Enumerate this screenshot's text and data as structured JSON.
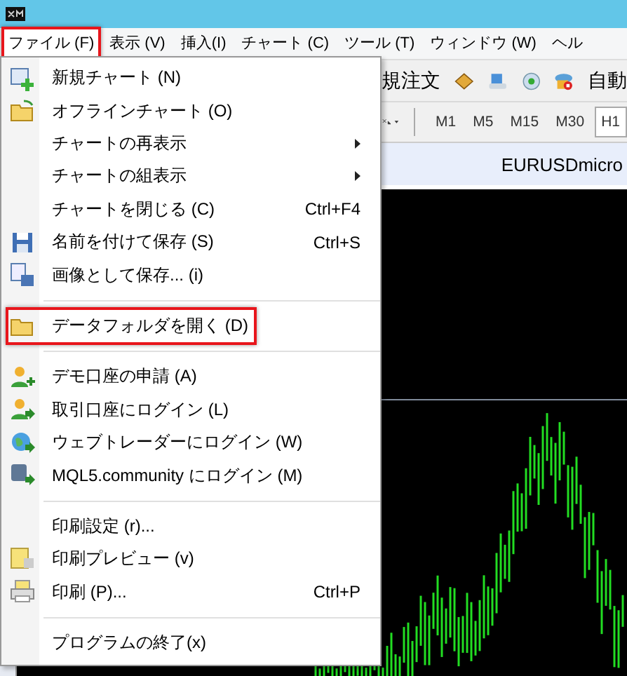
{
  "menubar": [
    {
      "label": "ファイル (F)",
      "selected": true
    },
    {
      "label": "表示 (V)",
      "selected": false
    },
    {
      "label": "挿入(I)",
      "selected": false
    },
    {
      "label": "チャート (C)",
      "selected": false
    },
    {
      "label": "ツール (T)",
      "selected": false
    },
    {
      "label": "ウィンドウ (W)",
      "selected": false
    },
    {
      "label": "ヘル",
      "selected": false
    }
  ],
  "toolbar": {
    "partial_label": "規注文",
    "trailing_label": "自動"
  },
  "timeframes": [
    {
      "label": "M1",
      "selected": false
    },
    {
      "label": "M5",
      "selected": false
    },
    {
      "label": "M15",
      "selected": false
    },
    {
      "label": "M30",
      "selected": false
    },
    {
      "label": "H1",
      "selected": true
    }
  ],
  "chart": {
    "title": "EURUSDmicro"
  },
  "file_menu": [
    {
      "kind": "item",
      "label": "新規チャート (N)",
      "highlighted": false
    },
    {
      "kind": "item",
      "label": "オフラインチャート (O)",
      "highlighted": false
    },
    {
      "kind": "submenu",
      "label": "チャートの再表示",
      "highlighted": false
    },
    {
      "kind": "submenu",
      "label": "チャートの組表示",
      "highlighted": false
    },
    {
      "kind": "item",
      "label": "チャートを閉じる (C)",
      "shortcut": "Ctrl+F4",
      "highlighted": false
    },
    {
      "kind": "item",
      "label": "名前を付けて保存 (S)",
      "shortcut": "Ctrl+S",
      "highlighted": false
    },
    {
      "kind": "item",
      "label": "画像として保存... (i)",
      "highlighted": false
    },
    {
      "kind": "separator"
    },
    {
      "kind": "item",
      "label": "データフォルダを開く (D)",
      "highlighted": true
    },
    {
      "kind": "separator"
    },
    {
      "kind": "item",
      "label": "デモ口座の申請 (A)",
      "highlighted": false
    },
    {
      "kind": "item",
      "label": "取引口座にログイン (L)",
      "highlighted": false
    },
    {
      "kind": "item",
      "label": "ウェブトレーダーにログイン (W)",
      "highlighted": false
    },
    {
      "kind": "item",
      "label": "MQL5.community にログイン (M)",
      "highlighted": false
    },
    {
      "kind": "separator"
    },
    {
      "kind": "item",
      "label": "印刷設定 (r)...",
      "highlighted": false
    },
    {
      "kind": "item",
      "label": "印刷プレビュー (v)",
      "highlighted": false
    },
    {
      "kind": "item",
      "label": "印刷 (P)...",
      "shortcut": "Ctrl+P",
      "highlighted": false
    },
    {
      "kind": "separator"
    },
    {
      "kind": "item",
      "label": "プログラムの終了(x)",
      "highlighted": false
    }
  ]
}
